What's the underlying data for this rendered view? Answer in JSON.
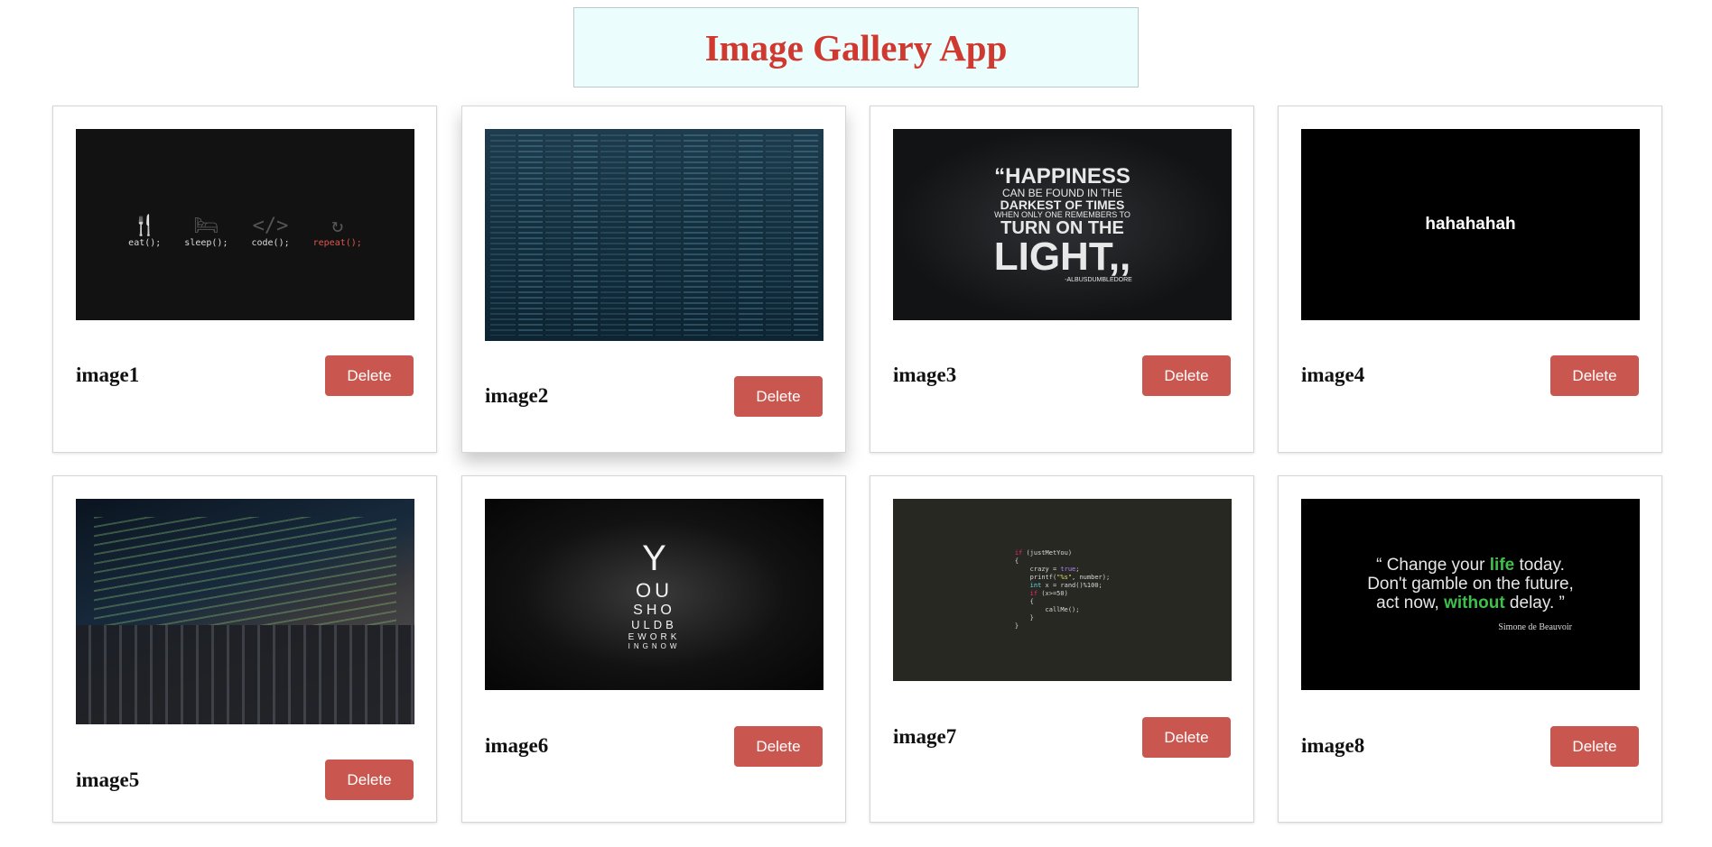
{
  "header": {
    "title": "Image Gallery App"
  },
  "delete_label": "Delete",
  "cards": [
    {
      "title": "image1"
    },
    {
      "title": "image2"
    },
    {
      "title": "image3"
    },
    {
      "title": "image4"
    },
    {
      "title": "image5"
    },
    {
      "title": "image6"
    },
    {
      "title": "image7"
    },
    {
      "title": "image8"
    }
  ],
  "images": {
    "image1": {
      "items": [
        "eat();",
        "sleep();",
        "code();",
        "repeat();"
      ]
    },
    "image3": {
      "lines": [
        "“HAPPINESS",
        "CAN BE FOUND IN THE",
        "DARKEST OF TIMES",
        "WHEN ONLY ONE REMEMBERS TO",
        "TURN ON THE",
        "LIGHT,,",
        "-ALBUSDUMBLEDORE"
      ]
    },
    "image4": {
      "text": "hahahahah"
    },
    "image6": {
      "lines": [
        "Y",
        "OU",
        "SHO",
        "ULDB",
        "EWORK",
        "INGNOW"
      ]
    },
    "image8": {
      "quote_a": "“ Change your ",
      "quote_hl1": "life",
      "quote_b": " today.",
      "quote_c": "Don't gamble on the future,",
      "quote_d": "act now, ",
      "quote_hl2": "without",
      "quote_e": " delay. ”",
      "author": "Simone de Beauvoir"
    }
  },
  "colors": {
    "title": "#d0392f",
    "header_bg": "#ebfdfd",
    "delete_bg": "#c9574f"
  }
}
